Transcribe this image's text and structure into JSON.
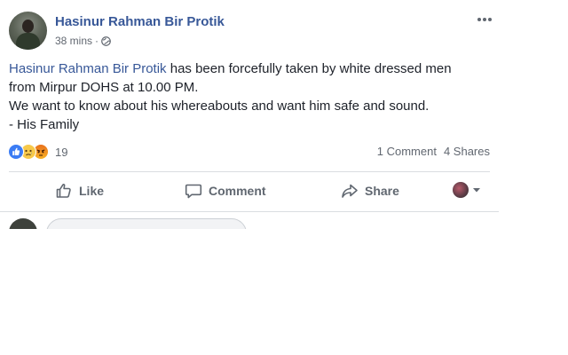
{
  "post": {
    "author": "Hasinur Rahman Bir Protik",
    "time": "38 mins",
    "separator": "·",
    "privacy_icon": "globe-icon",
    "more_icon": "ellipsis-icon",
    "text": {
      "mention": "Hasinur Rahman Bir Protik",
      "line1_rest": " has been forcefully taken by white dressed men",
      "line2": "from Mirpur DOHS at 10.00 PM.",
      "line3": "We want to know about his whereabouts and want him safe and sound.",
      "line4": "- His Family"
    },
    "reactions": {
      "icons": [
        "like-reaction-icon",
        "sad-reaction-icon",
        "angry-reaction-icon"
      ],
      "count": "19"
    },
    "comments_count": "1 Comment",
    "shares_count": "4 Shares"
  },
  "actions": {
    "like": "Like",
    "comment": "Comment",
    "share": "Share"
  },
  "colors": {
    "link": "#385898",
    "text": "#1d2129",
    "muted": "#616770",
    "like_blue": "#3b7cf4",
    "divider": "#dadde1"
  }
}
